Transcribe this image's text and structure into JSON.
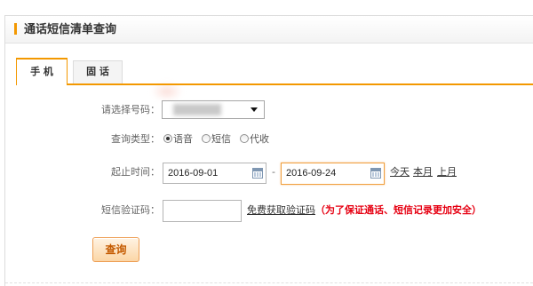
{
  "colors": {
    "accent": "#f39800",
    "notice": "#e60012",
    "focus_border": "#f0a040"
  },
  "panel": {
    "title": "通话短信清单查询"
  },
  "tabs": [
    {
      "label": "手 机",
      "active": true
    },
    {
      "label": "固 话",
      "active": false
    }
  ],
  "form": {
    "number": {
      "label": "请选择号码：",
      "icon": "chevron-down-icon"
    },
    "query_type": {
      "label": "查询类型：",
      "options": [
        {
          "label": "语音",
          "checked": true
        },
        {
          "label": "短信",
          "checked": false
        },
        {
          "label": "代收",
          "checked": false
        }
      ]
    },
    "date_range": {
      "label": "起止时间：",
      "start": "2016-09-01",
      "end": "2016-09-24",
      "separator": "-",
      "icon": "calendar-icon",
      "shortcuts": [
        "今天",
        "本月",
        "上月"
      ]
    },
    "sms_code": {
      "label": "短信验证码：",
      "value": "",
      "get_code_link": "免费获取验证码",
      "notice": "（为了保证通话、短信记录更加安全）"
    },
    "submit_label": "查询"
  }
}
